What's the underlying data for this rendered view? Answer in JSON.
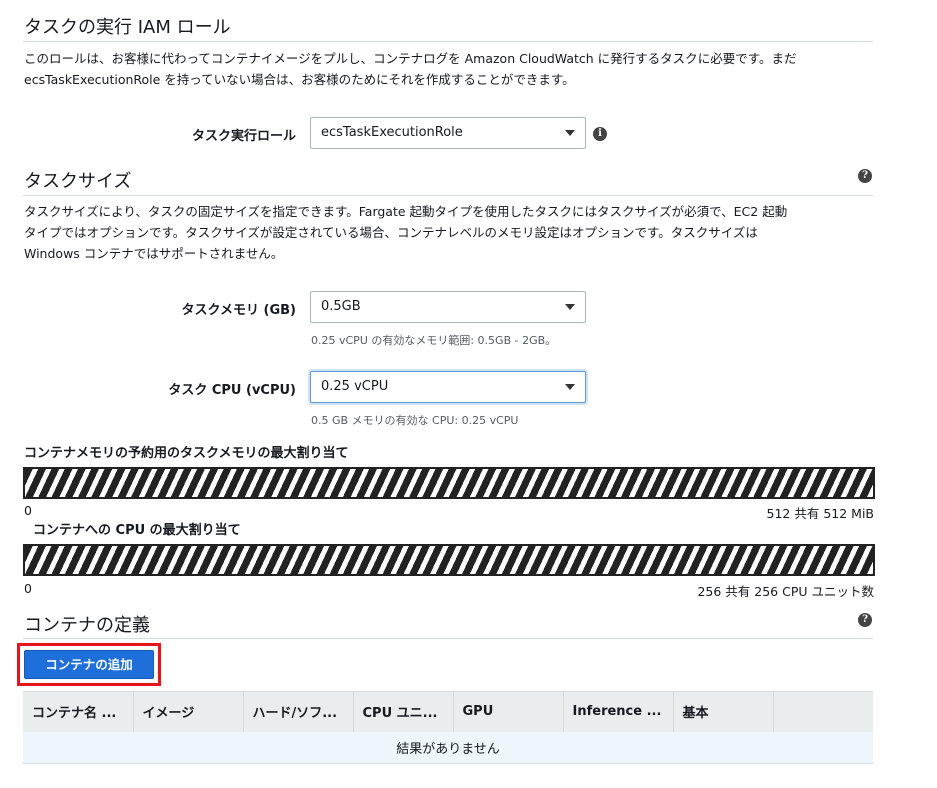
{
  "role_section": {
    "title": "タスクの実行 IAM ロール",
    "description_line1": "このロールは、お客様に代わってコンテナイメージをプルし、コンテナログを Amazon CloudWatch に発行するタスクに必要です。まだ",
    "description_line2": "ecsTaskExecutionRole を持っていない場合は、お客様のためにそれを作成することができます。",
    "field_label": "タスク実行ロール",
    "field_value": "ecsTaskExecutionRole",
    "info_icon": "i"
  },
  "size_section": {
    "title": "タスクサイズ",
    "help_icon": "?",
    "description_line1": "タスクサイズにより、タスクの固定サイズを指定できます。Fargate 起動タイプを使用したタスクにはタスクサイズが必須で、EC2 起動",
    "description_line2": "タイプではオプションです。タスクサイズが設定されている場合、コンテナレベルのメモリ設定はオプションです。タスクサイズは",
    "description_line3": "Windows コンテナではサポートされません。",
    "memory_label": "タスクメモリ (GB)",
    "memory_value": "0.5GB",
    "memory_hint": "0.25 vCPU の有効なメモリ範囲: 0.5GB - 2GB。",
    "cpu_label": "タスク CPU (vCPU)",
    "cpu_value": "0.25 vCPU",
    "cpu_hint": "0.5 GB メモリの有効な CPU: 0.25 vCPU"
  },
  "allocation": {
    "memory_title": "コンテナメモリの予約用のタスクメモリの最大割り当て",
    "memory_min": "0",
    "memory_max": "512 共有 512 MiB",
    "cpu_title": "コンテナへの CPU の最大割り当て",
    "cpu_min": "0",
    "cpu_max": "256 共有 256 CPU ユニット数"
  },
  "containers": {
    "title": "コンテナの定義",
    "help_icon": "?",
    "add_button": "コンテナの追加",
    "columns": [
      "コンテナ名 ...",
      "イメージ",
      "ハード/ソフ...",
      "CPU ユニ...",
      "GPU",
      "Inference ...",
      "基本",
      ""
    ],
    "empty_text": "結果がありません"
  },
  "colors": {
    "primary_button": "#1e6fd9",
    "highlight_border": "#e8141c"
  }
}
